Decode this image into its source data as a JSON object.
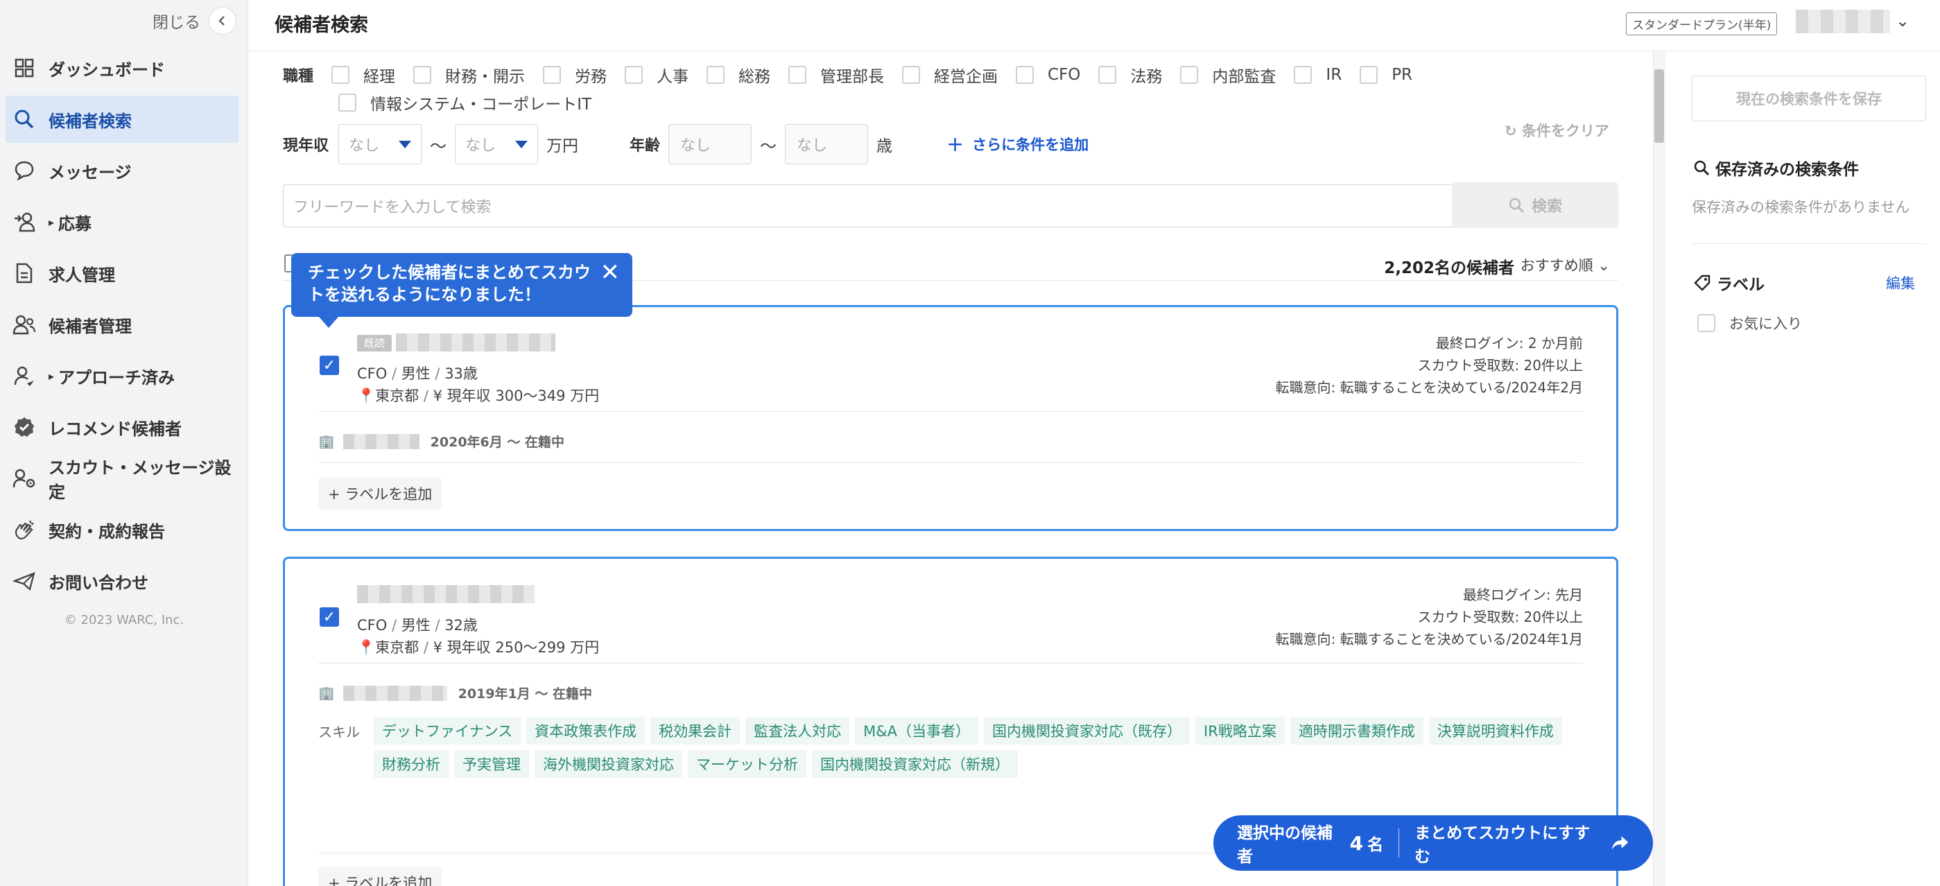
{
  "sidebar": {
    "close_label": "閉じる",
    "items": [
      {
        "label": "ダッシュボード",
        "icon": "dashboard-icon"
      },
      {
        "label": "候補者検索",
        "icon": "search-icon"
      },
      {
        "label": "メッセージ",
        "icon": "message-icon"
      },
      {
        "label": "応募",
        "icon": "applicant-icon"
      },
      {
        "label": "求人管理",
        "icon": "document-icon"
      },
      {
        "label": "候補者管理",
        "icon": "users-icon"
      },
      {
        "label": "アプローチ済み",
        "icon": "approach-icon"
      },
      {
        "label": "レコメンド候補者",
        "icon": "badge-check-icon"
      },
      {
        "label": "スカウト・メッセージ設定",
        "icon": "settings-users-icon"
      },
      {
        "label": "契約・成約報告",
        "icon": "clap-icon"
      },
      {
        "label": "お問い合わせ",
        "icon": "paper-plane-icon"
      }
    ],
    "copyright": "© 2023 WARC, Inc."
  },
  "header": {
    "title": "候補者検索",
    "plan": "スタンダードプラン(半年)"
  },
  "filters": {
    "job_label": "職種",
    "jobs_row1": [
      "経理",
      "財務・開示",
      "労務",
      "人事",
      "総務",
      "管理部長",
      "経営企画",
      "CFO",
      "法務",
      "内部監査",
      "IR",
      "PR"
    ],
    "jobs_row2": [
      "情報システム・コーポレートIT"
    ],
    "clear": "条件をクリア",
    "income_label": "現年収",
    "income_from": "なし",
    "income_to": "なし",
    "tilde": "〜",
    "income_unit": "万円",
    "age_label": "年齢",
    "age_from": "なし",
    "age_to": "なし",
    "age_unit": "歳",
    "add_condition": "さらに条件を追加",
    "keyword_placeholder": "フリーワードを入力して検索",
    "search_button": "検索"
  },
  "results": {
    "count": "2,202名の候補者",
    "sort": "おすすめ順"
  },
  "tooltip": {
    "text": "チェックした候補者にまとめてスカウトを送れるようになりました！"
  },
  "cards": [
    {
      "badge": "既読",
      "job": "CFO",
      "gender": "男性",
      "age": "33歳",
      "slash": "/",
      "location": "東京都",
      "income": "現年収 300〜349 万円",
      "last_login": "最終ログイン: 2 か月前",
      "scouts": "スカウト受取数: 20件以上",
      "intent": "転職意向: 転職することを決めている/2024年2月",
      "career_period": "2020年6月 〜 在籍中",
      "add_label": "+ ラベルを追加"
    },
    {
      "job": "CFO",
      "gender": "男性",
      "age": "32歳",
      "slash": "/",
      "location": "東京都",
      "income": "現年収 250〜299 万円",
      "last_login": "最終ログイン: 先月",
      "scouts": "スカウト受取数: 20件以上",
      "intent": "転職意向: 転職することを決めている/2024年1月",
      "career_period": "2019年1月 〜 在籍中",
      "skill_label": "スキル",
      "skills": [
        "デットファイナンス",
        "資本政策表作成",
        "税効果会計",
        "監査法人対応",
        "M&A（当事者）",
        "国内機関投資家対応（既存）",
        "IR戦略立案",
        "適時開示書類作成",
        "決算説明資料作成",
        "財務分析",
        "予実管理",
        "海外機関投資家対応",
        "マーケット分析",
        "国内機関投資家対応（新規）"
      ],
      "add_label": "+ ラベルを追加"
    }
  ],
  "right_panel": {
    "save_search": "現在の検索条件を保存",
    "saved_title": "保存済みの検索条件",
    "saved_empty": "保存済みの検索条件がありません",
    "label_title": "ラベル",
    "label_edit": "編集",
    "favorite": "お気に入り"
  },
  "fab": {
    "selected_prefix": "選択中の候補者",
    "selected_count": "4",
    "selected_suffix": "名",
    "action": "まとめてスカウトにすすむ"
  },
  "colors": {
    "accent": "#1f5fd8",
    "card_border": "#3a8de6",
    "skill_bg": "#eef7f4",
    "skill_text": "#2a8a75"
  }
}
